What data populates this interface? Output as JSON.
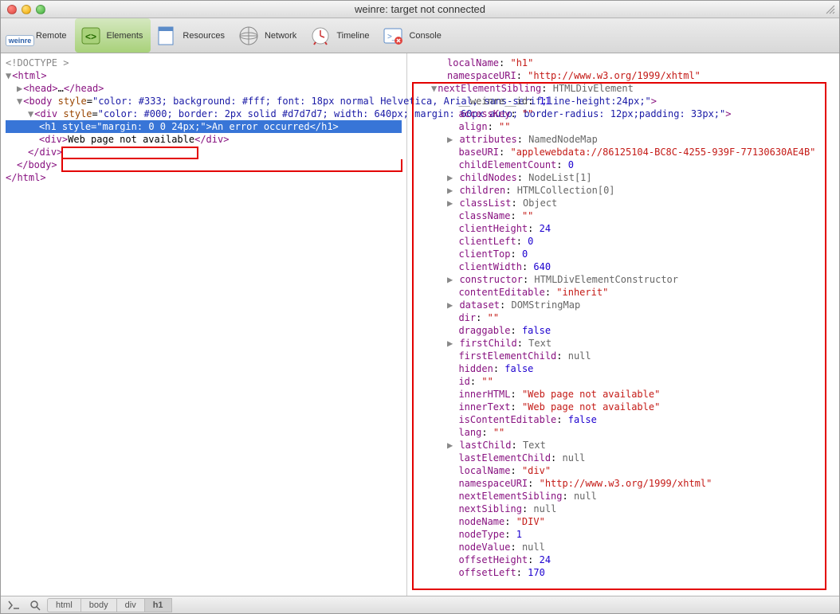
{
  "window": {
    "title": "weinre: target not connected"
  },
  "toolbar": {
    "remote": "Remote",
    "elements": "Elements",
    "resources": "Resources",
    "network": "Network",
    "timeline": "Timeline",
    "console": "Console",
    "weinre_badge": "weinre"
  },
  "dom": {
    "doctype": "<!DOCTYPE >",
    "html_open": "<html>",
    "head_open": "<head>",
    "head_ellipsis": "…",
    "head_close": "</head>",
    "body_open_tag": "body",
    "body_style": "color: #333; background: #fff; font: 18px normal Helvetica, Arial, sans-serif;line-height:24px;",
    "div1_open_tag": "div",
    "div1_style": "color: #000; border: 2px solid #d7d7d7; width: 640px; margin: 60px auto; border-radius: 12px;padding: 33px;",
    "h1_open_tag": "h1",
    "h1_style": "margin: 0 0 24px;",
    "h1_text": "An error occurred",
    "h1_close": "</h1>",
    "div2_open_tag": "div",
    "div2_text": "Web page not available",
    "div2_close": "</div>",
    "div1_close": "</div>",
    "body_close": "</body>",
    "html_close": "</html>"
  },
  "props_top": [
    {
      "key": "localName",
      "val": "\"h1\"",
      "cls": "str"
    },
    {
      "key": "namespaceURI",
      "val": "\"http://www.w3.org/1999/xhtml\"",
      "cls": "str"
    }
  ],
  "props_header": {
    "key": "nextElementSibling",
    "val": "HTMLDivElement"
  },
  "props": [
    {
      "key": "__weinre__id",
      "val": "11",
      "cls": "num",
      "dim": true
    },
    {
      "key": "accessKey",
      "val": "\"\"",
      "cls": "str"
    },
    {
      "key": "align",
      "val": "\"\"",
      "cls": "str"
    },
    {
      "key": "attributes",
      "val": "NamedNodeMap",
      "cls": "lit",
      "arrow": true
    },
    {
      "key": "baseURI",
      "val": "\"applewebdata://86125104-BC8C-4255-939F-77130630AE4B\"",
      "cls": "str"
    },
    {
      "key": "childElementCount",
      "val": "0",
      "cls": "num"
    },
    {
      "key": "childNodes",
      "val": "NodeList[1]",
      "cls": "lit",
      "arrow": true
    },
    {
      "key": "children",
      "val": "HTMLCollection[0]",
      "cls": "lit",
      "arrow": true
    },
    {
      "key": "classList",
      "val": "Object",
      "cls": "lit",
      "arrow": true
    },
    {
      "key": "className",
      "val": "\"\"",
      "cls": "str"
    },
    {
      "key": "clientHeight",
      "val": "24",
      "cls": "num"
    },
    {
      "key": "clientLeft",
      "val": "0",
      "cls": "num"
    },
    {
      "key": "clientTop",
      "val": "0",
      "cls": "num"
    },
    {
      "key": "clientWidth",
      "val": "640",
      "cls": "num"
    },
    {
      "key": "constructor",
      "val": "HTMLDivElementConstructor",
      "cls": "lit",
      "arrow": true
    },
    {
      "key": "contentEditable",
      "val": "\"inherit\"",
      "cls": "str"
    },
    {
      "key": "dataset",
      "val": "DOMStringMap",
      "cls": "lit",
      "arrow": true
    },
    {
      "key": "dir",
      "val": "\"\"",
      "cls": "str"
    },
    {
      "key": "draggable",
      "val": "false",
      "cls": "num"
    },
    {
      "key": "firstChild",
      "val": "Text",
      "cls": "lit",
      "arrow": true
    },
    {
      "key": "firstElementChild",
      "val": "null",
      "cls": "lit"
    },
    {
      "key": "hidden",
      "val": "false",
      "cls": "num"
    },
    {
      "key": "id",
      "val": "\"\"",
      "cls": "str"
    },
    {
      "key": "innerHTML",
      "val": "\"Web page not available\"",
      "cls": "str"
    },
    {
      "key": "innerText",
      "val": "\"Web page not available\"",
      "cls": "str"
    },
    {
      "key": "isContentEditable",
      "val": "false",
      "cls": "num"
    },
    {
      "key": "lang",
      "val": "\"\"",
      "cls": "str"
    },
    {
      "key": "lastChild",
      "val": "Text",
      "cls": "lit",
      "arrow": true
    },
    {
      "key": "lastElementChild",
      "val": "null",
      "cls": "lit"
    },
    {
      "key": "localName",
      "val": "\"div\"",
      "cls": "str"
    },
    {
      "key": "namespaceURI",
      "val": "\"http://www.w3.org/1999/xhtml\"",
      "cls": "str"
    },
    {
      "key": "nextElementSibling",
      "val": "null",
      "cls": "lit"
    },
    {
      "key": "nextSibling",
      "val": "null",
      "cls": "lit"
    },
    {
      "key": "nodeName",
      "val": "\"DIV\"",
      "cls": "str"
    },
    {
      "key": "nodeType",
      "val": "1",
      "cls": "num"
    },
    {
      "key": "nodeValue",
      "val": "null",
      "cls": "lit"
    },
    {
      "key": "offsetHeight",
      "val": "24",
      "cls": "num"
    },
    {
      "key": "offsetLeft",
      "val": "170",
      "cls": "num"
    }
  ],
  "breadcrumbs": [
    "html",
    "body",
    "div",
    "h1"
  ]
}
